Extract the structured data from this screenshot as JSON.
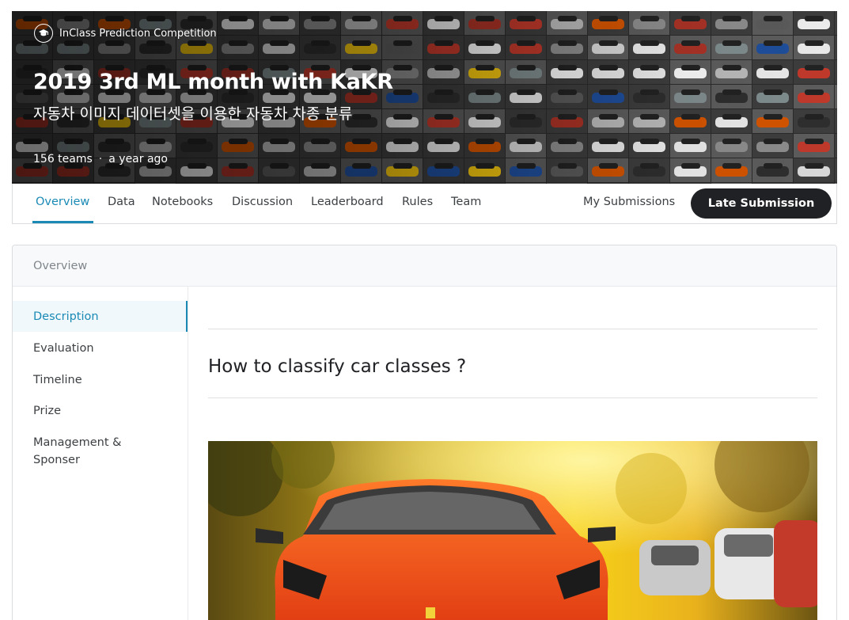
{
  "banner": {
    "competition_type": "InClass Prediction Competition",
    "title": "2019 3rd ML month with KaKR",
    "subtitle": "자동차 이미지 데이터셋을 이용한 자동차 차종 분류",
    "teams": "156 teams",
    "separator": "·",
    "time_ago": "a year ago",
    "icon": "graduation-cap-icon"
  },
  "tabs": [
    {
      "label": "Overview",
      "active": true
    },
    {
      "label": "Data"
    },
    {
      "label": "Notebooks"
    },
    {
      "label": "Discussion"
    },
    {
      "label": "Leaderboard"
    },
    {
      "label": "Rules"
    },
    {
      "label": "Team"
    }
  ],
  "actions": {
    "my_submissions": "My Submissions",
    "late_submission": "Late Submission"
  },
  "overview": {
    "header": "Overview",
    "sidebar": [
      {
        "label": "Description",
        "active": true
      },
      {
        "label": "Evaluation"
      },
      {
        "label": "Timeline"
      },
      {
        "label": "Prize"
      },
      {
        "label": "Management & Sponser"
      }
    ],
    "heading": "How to classify car classes ?"
  },
  "colors": {
    "accent": "#1a8ab5",
    "button_dark": "#202124"
  }
}
